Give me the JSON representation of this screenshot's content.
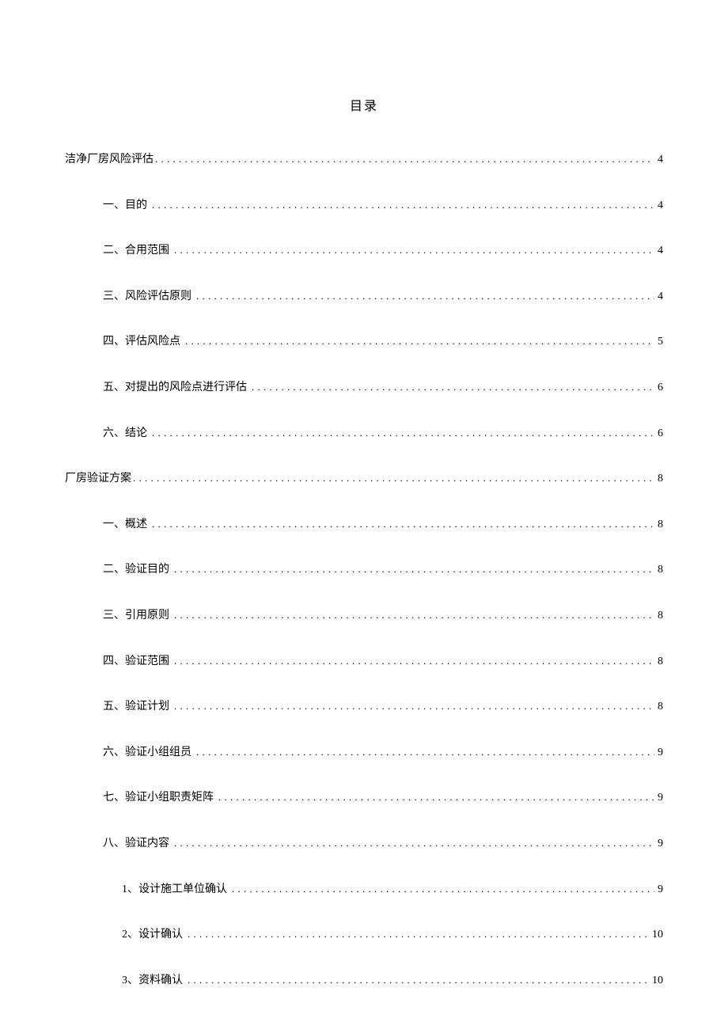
{
  "title": "目录",
  "entries": [
    {
      "level": 0,
      "label": "洁净厂房风险评估",
      "page": "4"
    },
    {
      "level": 1,
      "label": "一、目的",
      "page": "4"
    },
    {
      "level": 1,
      "label": "二、合用范围",
      "page": "4"
    },
    {
      "level": 1,
      "label": "三、风险评估原则",
      "page": "4"
    },
    {
      "level": 1,
      "label": "四、评估风险点",
      "page": "5"
    },
    {
      "level": 1,
      "label": "五、对提出的风险点进行评估",
      "page": "6"
    },
    {
      "level": 1,
      "label": "六、结论",
      "page": "6"
    },
    {
      "level": 0,
      "label": "厂房验证方案",
      "page": "8"
    },
    {
      "level": 1,
      "label": "一、概述",
      "page": "8"
    },
    {
      "level": 1,
      "label": "二、验证目的",
      "page": "8"
    },
    {
      "level": 1,
      "label": "三、引用原则",
      "page": "8"
    },
    {
      "level": 1,
      "label": "四、验证范围",
      "page": "8"
    },
    {
      "level": 1,
      "label": "五、验证计划",
      "page": "8"
    },
    {
      "level": 1,
      "label": "六、验证小组组员",
      "page": "9"
    },
    {
      "level": 1,
      "label": "七、验证小组职责矩阵",
      "page": "9"
    },
    {
      "level": 1,
      "label": "八、验证内容",
      "page": "9"
    },
    {
      "level": 2,
      "label": "1、设计施工单位确认",
      "page": "9"
    },
    {
      "level": 2,
      "label": "2、设计确认",
      "page": "10"
    },
    {
      "level": 2,
      "label": "3、资料确认",
      "page": "10"
    }
  ]
}
